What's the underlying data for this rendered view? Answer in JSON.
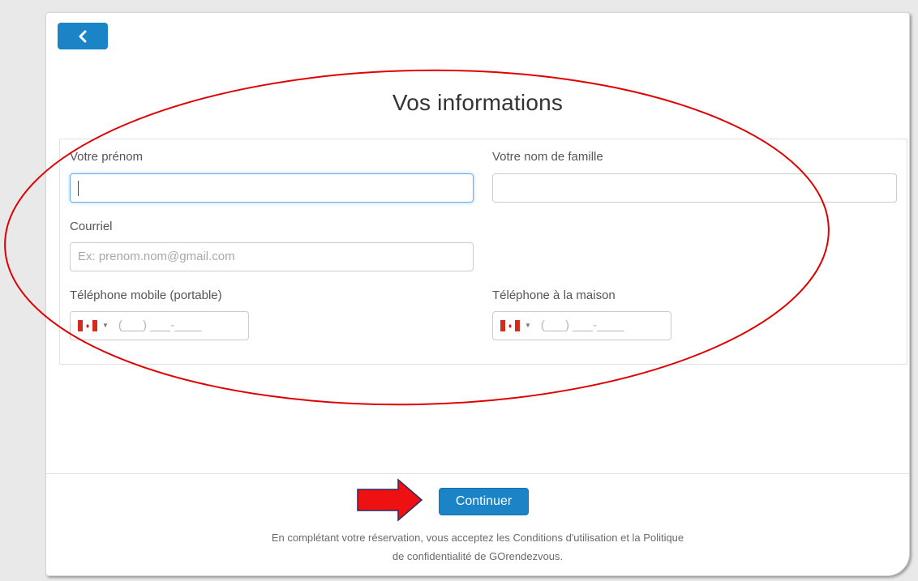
{
  "page": {
    "title": "Vos informations",
    "back_icon": "chevron-left-icon"
  },
  "form": {
    "first_name": {
      "label": "Votre prénom",
      "value": "",
      "placeholder": ""
    },
    "last_name": {
      "label": "Votre nom de famille",
      "value": "",
      "placeholder": ""
    },
    "email": {
      "label": "Courriel",
      "value": "",
      "placeholder": "Ex: prenom.nom@gmail.com"
    },
    "mobile_phone": {
      "label": "Téléphone mobile (portable)",
      "country": "Canada",
      "mask": "(___) ___-____"
    },
    "home_phone": {
      "label": "Téléphone à la maison",
      "country": "Canada",
      "mask": "(___) ___-____"
    }
  },
  "actions": {
    "continue_label": "Continuer"
  },
  "footer": {
    "line1": "En complétant votre réservation, vous acceptez les Conditions d'utilisation et la Politique",
    "line2": "de confidentialité de GOrendezvous."
  },
  "colors": {
    "primary": "#1a84c7",
    "annotation": "#e00000"
  }
}
